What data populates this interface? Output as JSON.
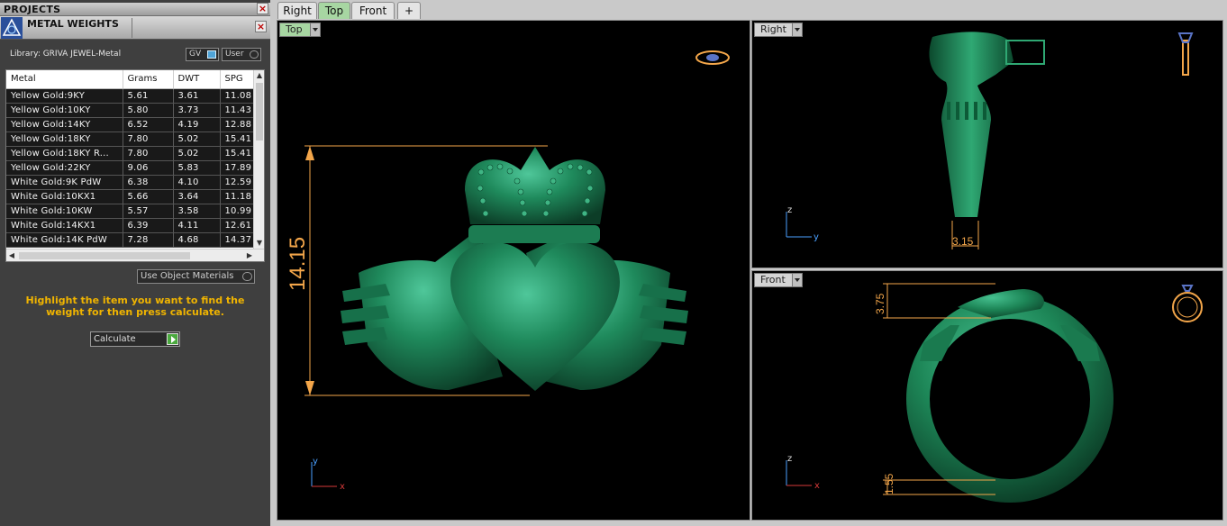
{
  "projects_bar": {
    "title": "PROJECTS"
  },
  "metal_weights": {
    "title": "METAL WEIGHTS",
    "library": "Library: GRIVA JEWEL-Metal",
    "toggle_gv": "GV",
    "toggle_user": "User",
    "columns": [
      "Metal",
      "Grams",
      "DWT",
      "SPG"
    ],
    "rows": [
      [
        "Yellow Gold:9KY",
        "5.61",
        "3.61",
        "11.08"
      ],
      [
        "Yellow Gold:10KY",
        "5.80",
        "3.73",
        "11.43"
      ],
      [
        "Yellow Gold:14KY",
        "6.52",
        "4.19",
        "12.88"
      ],
      [
        "Yellow Gold:18KY",
        "7.80",
        "5.02",
        "15.41"
      ],
      [
        "Yellow Gold:18KY R...",
        "7.80",
        "5.02",
        "15.41"
      ],
      [
        "Yellow Gold:22KY",
        "9.06",
        "5.83",
        "17.89"
      ],
      [
        "White Gold:9K PdW",
        "6.38",
        "4.10",
        "12.59"
      ],
      [
        "White Gold:10KX1",
        "5.66",
        "3.64",
        "11.18"
      ],
      [
        "White Gold:10KW",
        "5.57",
        "3.58",
        "10.99"
      ],
      [
        "White Gold:14KX1",
        "6.39",
        "4.11",
        "12.61"
      ],
      [
        "White Gold:14K PdW",
        "7.28",
        "4.68",
        "14.37"
      ]
    ],
    "use_object_materials": "Use Object Materials",
    "hint": "Highlight the item you want to find the weight for then press calculate.",
    "calculate": "Calculate"
  },
  "tabs": [
    "Right",
    "Top",
    "Front",
    "+"
  ],
  "viewports": {
    "top": {
      "label": "Top",
      "dimension": "14.15",
      "axis_x": "x",
      "axis_y": "y"
    },
    "right": {
      "label": "Right",
      "dimension": "3.15",
      "axis_x": "y",
      "axis_y": "z"
    },
    "front": {
      "label": "Front",
      "dimension_top": "3.75",
      "dimension_bottom": "1.55",
      "axis_x": "x",
      "axis_y": "z"
    }
  },
  "colors": {
    "model": "#1f7a4f",
    "dimension": "#f3a64a",
    "active_tab": "#a7d6a2"
  }
}
